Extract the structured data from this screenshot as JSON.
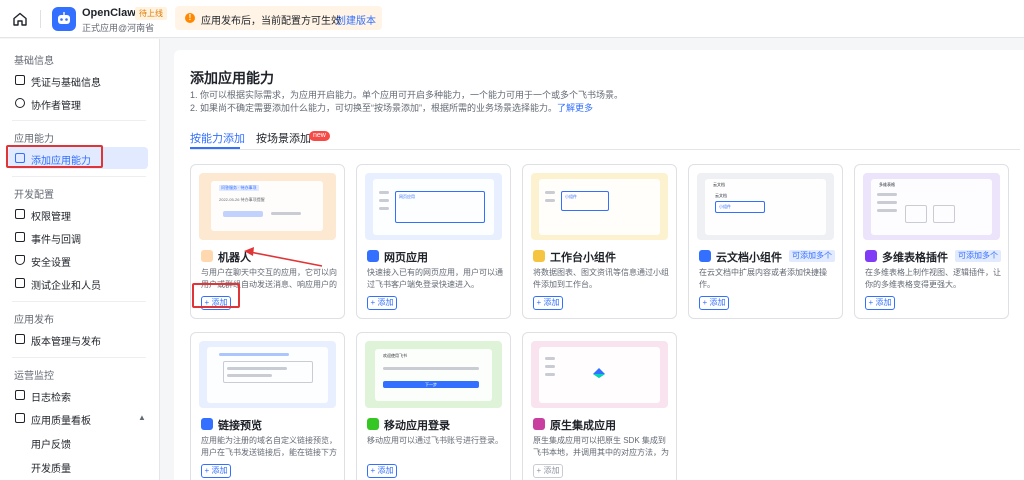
{
  "header": {
    "app_name": "OpenClaw",
    "status_badge": "待上线",
    "app_sub": "正式应用@河南省",
    "notice_icon": "!",
    "notice_text": "应用发布后，当前配置方可生效",
    "notice_link": "创建版本"
  },
  "sidebar": {
    "sections": {
      "basic": "基础信息",
      "ability": "应用能力",
      "dev": "开发配置",
      "publish": "应用发布",
      "ops": "运营监控"
    },
    "items": {
      "credentials": "凭证与基础信息",
      "collaborators": "协作者管理",
      "add_ability": "添加应用能力",
      "permissions": "权限管理",
      "events": "事件与回调",
      "security": "安全设置",
      "test_org": "测试企业和人员",
      "versions": "版本管理与发布",
      "logs": "日志检索",
      "quality": "应用质量看板",
      "feedback": "用户反馈",
      "dev_quality": "开发质量"
    }
  },
  "main": {
    "title": "添加应用能力",
    "desc1": "1. 你可以根据实际需求，为应用开启能力。单个应用可开启多种能力，一个能力可用于一个或多个飞书场景。",
    "desc2": "2. 如果尚不确定需要添加什么能力，可切换至“按场景添加”，根据所需的业务场景选择能力。",
    "desc_link": "了解更多",
    "tabs": [
      "按能力添加",
      "按场景添加"
    ],
    "tab_new_badge": "new",
    "cards": [
      {
        "title": "机器人",
        "tag": "",
        "desc": "与用户在聊天中交互的应用，它可以向用户或群组自动发送消息、响应用户的消...",
        "add": "+ 添加"
      },
      {
        "title": "网页应用",
        "tag": "",
        "desc": "快速接入已有的网页应用，用户可以通过飞书客户端免登录快速进入。",
        "add": "+ 添加"
      },
      {
        "title": "工作台小组件",
        "tag": "",
        "desc": "将数据图表、图文资讯等信息通过小组件添加到工作台。",
        "add": "+ 添加"
      },
      {
        "title": "云文档小组件",
        "tag": "可添加多个",
        "desc": "在云文档中扩展内容或者添加快捷操作。",
        "add": "+ 添加"
      },
      {
        "title": "多维表格插件",
        "tag": "可添加多个",
        "desc": "在多维表格上制作视图、逻辑插件，让你的多维表格变得更强大。",
        "add": "+ 添加"
      },
      {
        "title": "链接预览",
        "tag": "",
        "desc": "应用能为注册的域名自定义链接预览，用户在飞书发送链接后，能在链接下方展示...",
        "add": "+ 添加"
      },
      {
        "title": "移动应用登录",
        "tag": "",
        "desc": "移动应用可以通过飞书账号进行登录。",
        "add": "+ 添加"
      },
      {
        "title": "原生集成应用",
        "tag": "",
        "desc": "原生集成应用可以把原生 SDK 集成到飞书本地，并调用其中的对应方法，为用户提...",
        "add": "+ 添加"
      }
    ],
    "thumb_texts": {
      "bot_chip": "问答服务 · 待办事项",
      "bot_date": "2022-05-26 待办事项提醒",
      "web_chip": "网页应用",
      "widget_chip": "小组件",
      "docs_title": "云文档",
      "docs_sub": "云文档",
      "docs_widget": "小组件",
      "base_title": "多维表格",
      "login_title": "欢迎使用飞书",
      "login_next": "下一步"
    }
  },
  "colors": {
    "accent": "#3370ff",
    "highlight_red": "#e03537",
    "badge_orange": "#de7802"
  }
}
